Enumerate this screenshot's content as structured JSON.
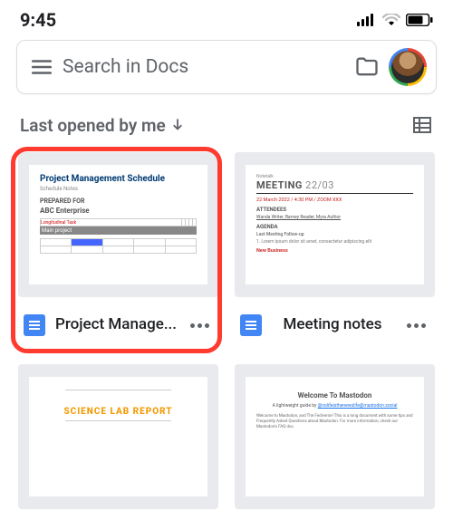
{
  "status": {
    "time": "9:45"
  },
  "search": {
    "placeholder": "Search in Docs"
  },
  "sort": {
    "label": "Last opened by me"
  },
  "docs": [
    {
      "title": "Project Manage...",
      "preview": {
        "heading": "Project Management Schedule",
        "sub": "Schedule Notes",
        "prepared_for_lbl": "PREPARED FOR",
        "prepared_for": "ABC Enterprise",
        "section": "Main project"
      }
    },
    {
      "title": "Meeting notes",
      "preview": {
        "brand": "Notetalk",
        "heading_strong": "MEETING",
        "heading_light": "22/03",
        "meta": "22 March 2022 / 4:30 PM / ZOOM XXX",
        "attendees_lbl": "ATTENDEES",
        "attendees": "Wanda Writer, Barney Reader, Myra Author",
        "agenda_lbl": "AGENDA",
        "agenda_item": "Last Meeting Follow-up",
        "agenda_line": "1. Lorem ipsum dolor sit amet, consectetur adipiscing elit",
        "new_lbl": "New Business"
      }
    },
    {
      "title": "",
      "preview": {
        "heading": "SCIENCE LAB REPORT"
      }
    },
    {
      "title": "",
      "preview": {
        "heading": "Welcome To Mastodon",
        "byline": "A lightweight guide by",
        "link": "@nolifeisthenewslife@mastodon.social",
        "para": "Welcome to Mastodon, and The Fediverse! This is a long document with some tips and Frequently Asked Questions about Mastodon. For more information, check our Mastodon's FAQ doc."
      }
    }
  ]
}
